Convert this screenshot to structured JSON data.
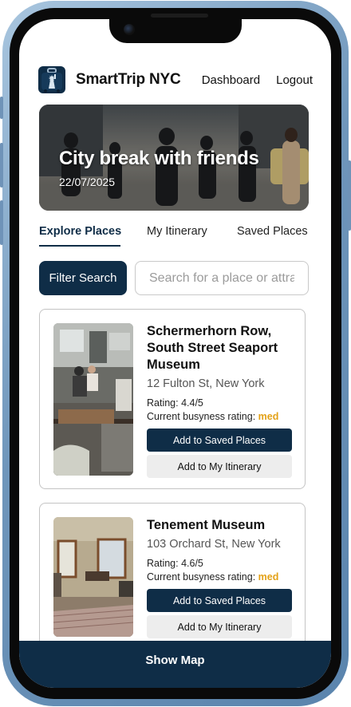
{
  "app": {
    "name": "SmartTrip NYC"
  },
  "nav": {
    "dashboard": "Dashboard",
    "logout": "Logout"
  },
  "hero": {
    "title": "City break with friends",
    "date": "22/07/2025"
  },
  "tabs": [
    {
      "label": "Explore Places",
      "active": true
    },
    {
      "label": "My Itinerary",
      "active": false
    },
    {
      "label": "Saved Places",
      "active": false
    }
  ],
  "search": {
    "filter_label": "Filter Search",
    "placeholder": "Search for a place or attraction"
  },
  "places": [
    {
      "name": "Schermerhorn Row, South Street Seaport Museum",
      "address": "12 Fulton St, New York",
      "rating": "Rating: 4.4/5",
      "busy_label": "Current busyness rating:",
      "busy_value": "med",
      "save_label": "Add to Saved Places",
      "itinerary_label": "Add to My Itinerary"
    },
    {
      "name": "Tenement Museum",
      "address": "103 Orchard St, New York",
      "rating": "Rating: 4.6/5",
      "busy_label": "Current busyness rating:",
      "busy_value": "med",
      "save_label": "Add to Saved Places",
      "itinerary_label": "Add to My Itinerary"
    }
  ],
  "footer": {
    "show_map": "Show Map"
  },
  "colors": {
    "primary": "#0f2d47",
    "busy": "#e3a117",
    "frame": "#6f96bb"
  }
}
